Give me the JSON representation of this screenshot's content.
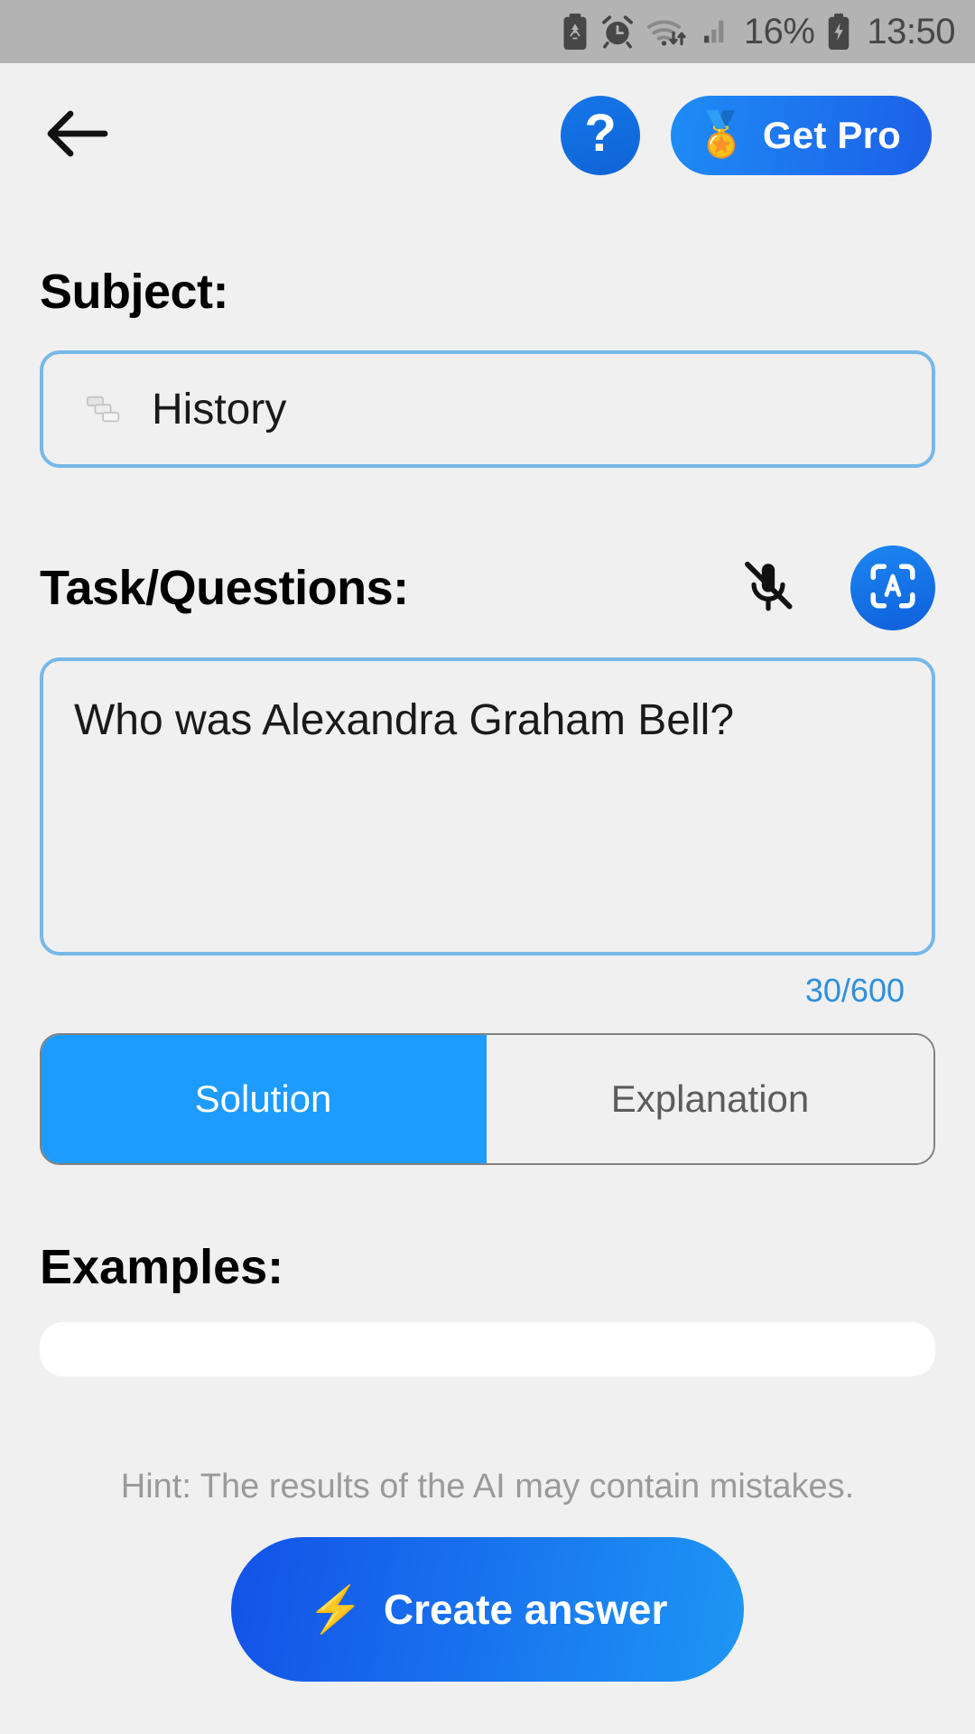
{
  "status_bar": {
    "battery_percent": "16%",
    "time": "13:50",
    "icons": [
      "battery-saver-icon",
      "alarm-clock-icon",
      "wifi-transfer-icon",
      "cellular-signal-icon",
      "battery-charging-icon"
    ],
    "background_color": "#B3B3B3",
    "text_color": "#474747"
  },
  "top_bar": {
    "back_label": "back-arrow-icon",
    "help_label": "?",
    "pro_button": {
      "label": "Get Pro",
      "icon": "🏅"
    }
  },
  "subject": {
    "title": "Subject:",
    "value": "History",
    "icon": "scroll-icon"
  },
  "task": {
    "title": "Task/Questions:",
    "mic_icon": "microphone-off-icon",
    "scan_icon": "scan-text-icon",
    "value": "Who was Alexandra Graham Bell?",
    "placeholder": "",
    "counter": "30/600",
    "char_count": 30,
    "char_max": 600
  },
  "mode_toggle": {
    "options": [
      {
        "label": "Solution",
        "selected": true
      },
      {
        "label": "Explanation",
        "selected": false
      }
    ]
  },
  "examples": {
    "title": "Examples:"
  },
  "footer": {
    "hint": "Hint: The results of the AI may contain mistakes.",
    "cta_label": "Create answer",
    "cta_icon": "⚡"
  },
  "colors": {
    "accent_blue": "#1E9BFF",
    "border_blue": "#76B8E8",
    "counter_blue": "#2E8FDE",
    "page_bg": "#F0F0F0",
    "hint_gray": "#9A9A9A"
  }
}
